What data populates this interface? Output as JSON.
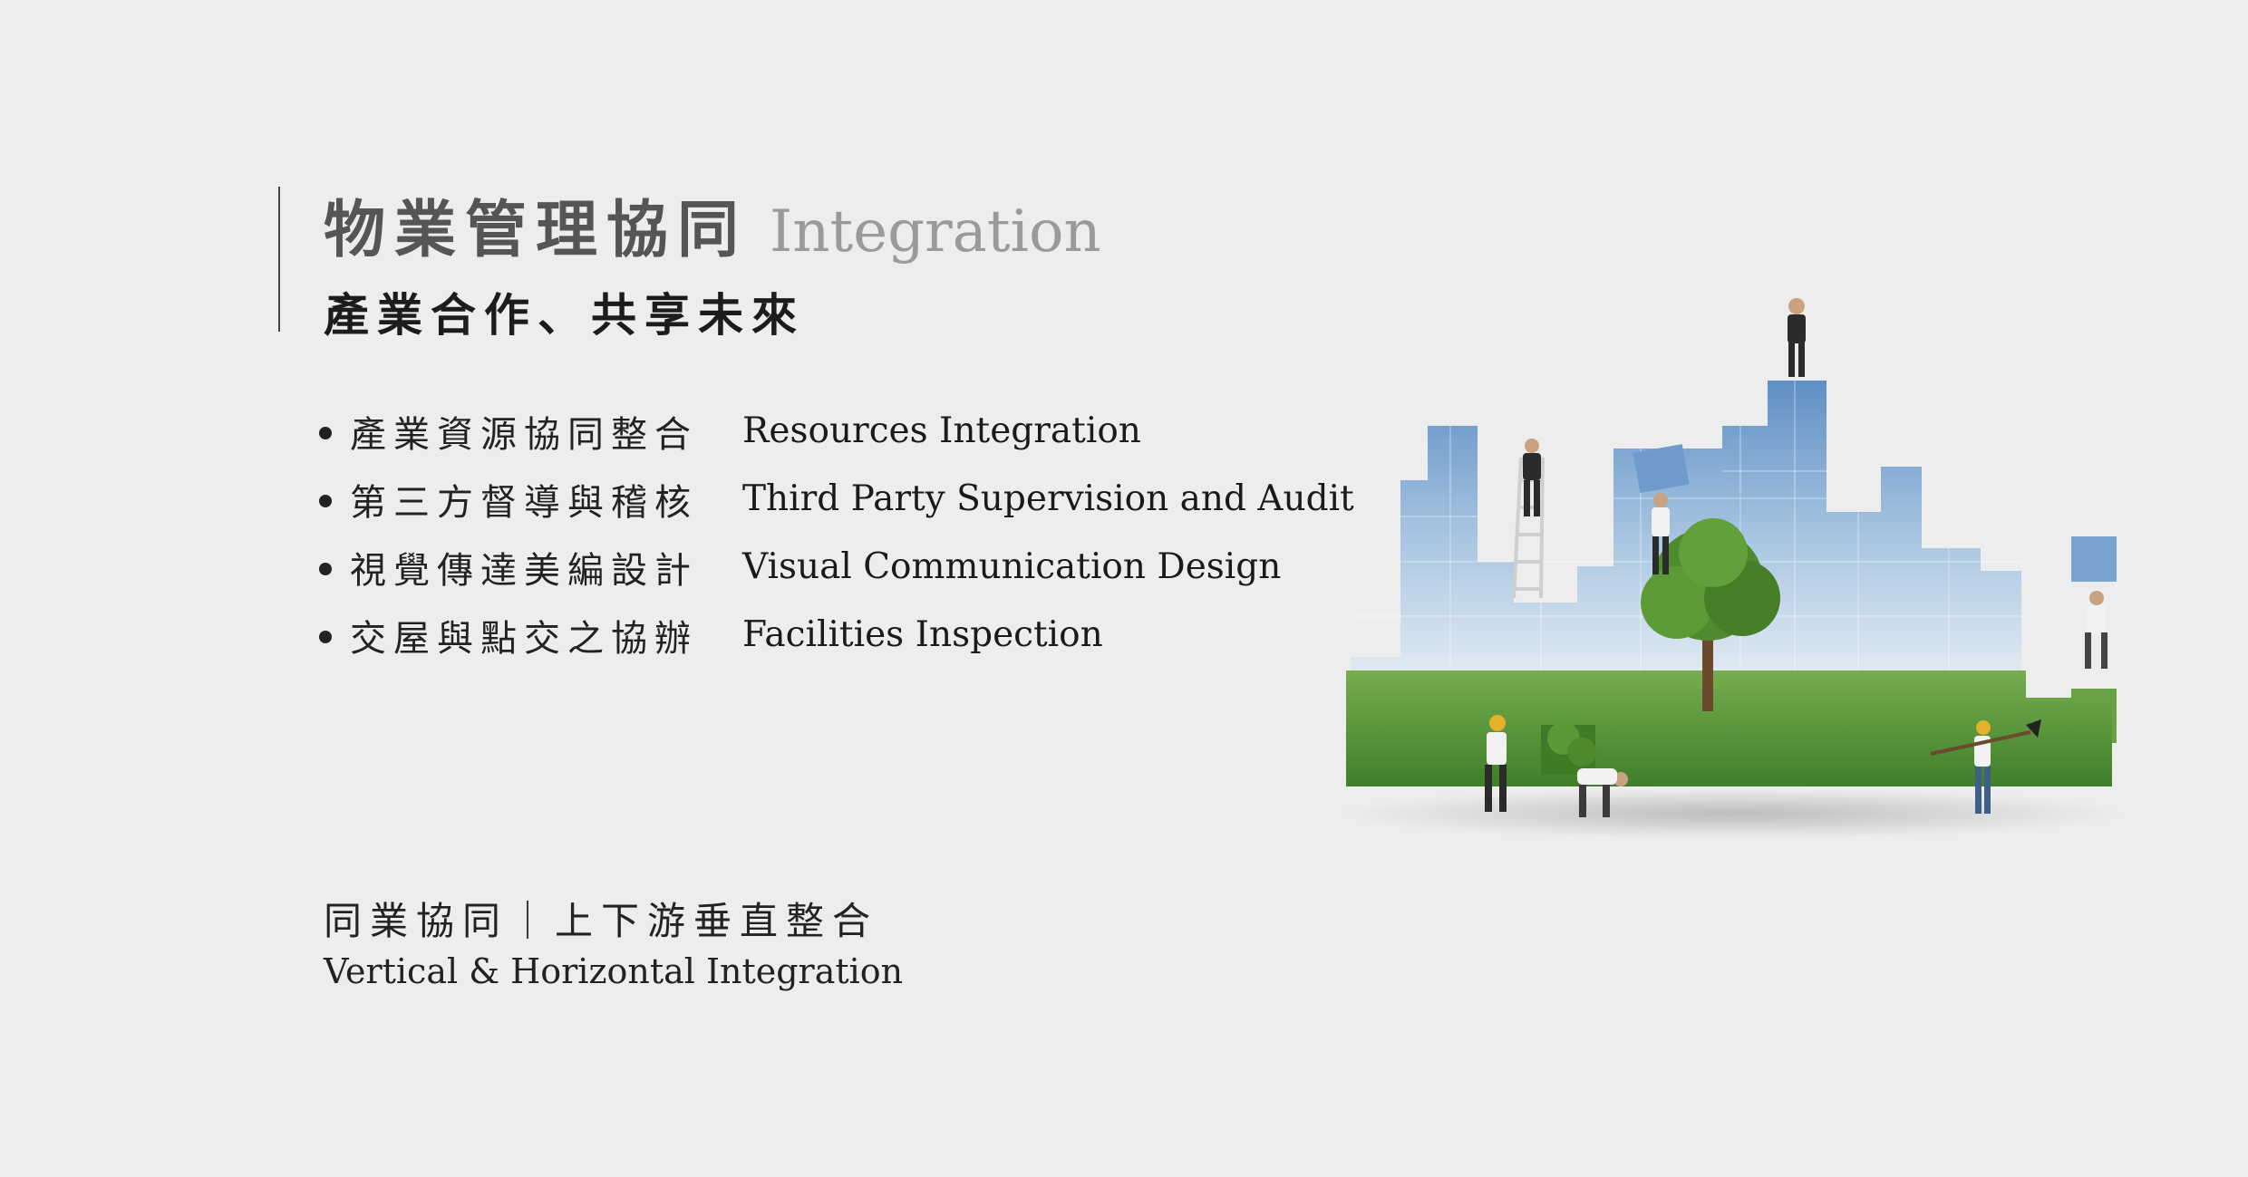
{
  "header": {
    "title_zh": "物業管理協同",
    "title_en": "Integration",
    "subtitle": "產業合作、共享未來"
  },
  "services": [
    {
      "zh": "產業資源協同整合",
      "en": "Resources Integration"
    },
    {
      "zh": "第三方督導與稽核",
      "en": "Third Party Supervision and Audit"
    },
    {
      "zh": "視覺傳達美編設計",
      "en": "Visual Communication Design"
    },
    {
      "zh": "交屋與點交之協辦",
      "en": "Facilities Inspection"
    }
  ],
  "footer": {
    "zh": "同業協同｜上下游垂直整合",
    "en": "Vertical & Horizontal Integration"
  },
  "illustration": {
    "description_icon": "puzzle-city-icon",
    "colors": {
      "sky": "#8fb4d8",
      "grass": "#5a9a3a",
      "tree": "#4f8a2e"
    }
  }
}
